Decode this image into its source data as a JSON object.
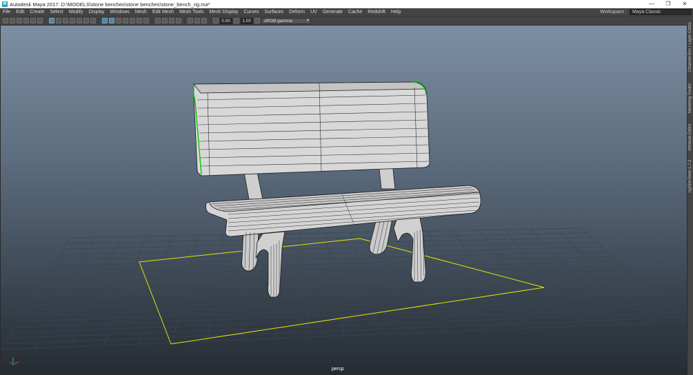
{
  "window": {
    "title": "Autodesk Maya 2017: D:\\MODELS\\stone benches\\stone benches\\stone_bench_rig.ma*",
    "app_icon": "M",
    "minimize": "—",
    "restore": "❐",
    "close": "✕"
  },
  "menubar": {
    "items": [
      "File",
      "Edit",
      "Create",
      "Select",
      "Modify",
      "Display",
      "Windows",
      "Mesh",
      "Edit Mesh",
      "Mesh Tools",
      "Mesh Display",
      "Curves",
      "Surfaces",
      "Deform",
      "UV",
      "Generate",
      "Cache",
      "Redshift",
      "Help"
    ],
    "workspace_label": "Workspace :",
    "workspace_value": "Maya Classic"
  },
  "toolbar": {
    "field_a": "0.00",
    "field_b": "1.00",
    "color_space": "sRGB gamma"
  },
  "viewport": {
    "camera": "persp",
    "colors": {
      "grid": "#3c4650",
      "selection": "#e5e500",
      "mesh_fill": "#d6d6d6",
      "wire": "#1a1a1a",
      "highlight": "#00c800"
    }
  },
  "side_tabs": [
    "Channel Box / Layer Editor",
    "Modeling Toolkit",
    "Attribute Editor",
    "ngSkinTools 1.7.3"
  ]
}
